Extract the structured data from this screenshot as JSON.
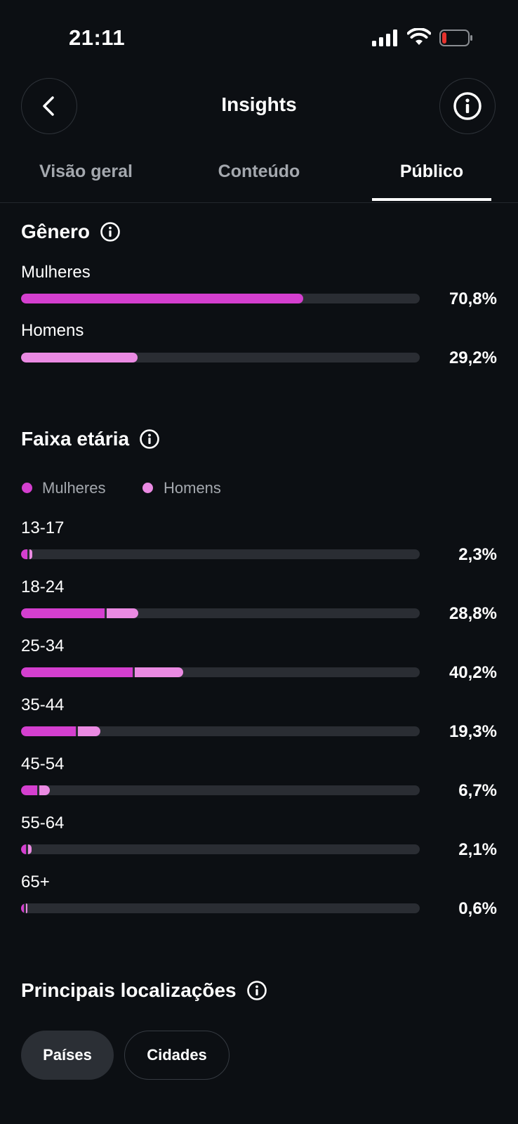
{
  "status_bar": {
    "time": "21:11",
    "battery_level": 0.1,
    "battery_color": "#e5322d"
  },
  "header": {
    "title": "Insights",
    "back_icon": "chevron-left-icon",
    "info_icon": "info-icon"
  },
  "tabs": [
    {
      "label": "Visão geral",
      "active": false
    },
    {
      "label": "Conteúdo",
      "active": false
    },
    {
      "label": "Público",
      "active": true
    }
  ],
  "colors": {
    "women": "#d43fcf",
    "men": "#ea8ae2",
    "track": "#2a2d33",
    "background": "#0c0f13"
  },
  "gender": {
    "title": "Gênero",
    "rows": [
      {
        "label": "Mulheres",
        "value": 70.8,
        "pct_text": "70,8%"
      },
      {
        "label": "Homens",
        "value": 29.2,
        "pct_text": "29,2%"
      }
    ]
  },
  "age": {
    "title": "Faixa etária",
    "legend": {
      "women": "Mulheres",
      "men": "Homens"
    },
    "rows": [
      {
        "label": "13-17",
        "women": 1.5,
        "men": 0.8,
        "pct_text": "2,3%"
      },
      {
        "label": "18-24",
        "women": 21.0,
        "men": 7.8,
        "pct_text": "28,8%"
      },
      {
        "label": "25-34",
        "women": 28.0,
        "men": 12.2,
        "pct_text": "40,2%"
      },
      {
        "label": "35-44",
        "women": 13.7,
        "men": 5.6,
        "pct_text": "19,3%"
      },
      {
        "label": "45-54",
        "women": 4.0,
        "men": 2.7,
        "pct_text": "6,7%"
      },
      {
        "label": "55-64",
        "women": 1.3,
        "men": 0.8,
        "pct_text": "2,1%"
      },
      {
        "label": "65+",
        "women": 0.4,
        "men": 0.2,
        "pct_text": "0,6%"
      }
    ]
  },
  "locations": {
    "title": "Principais localizações",
    "chips": [
      {
        "label": "Países",
        "active": true
      },
      {
        "label": "Cidades",
        "active": false
      }
    ]
  }
}
